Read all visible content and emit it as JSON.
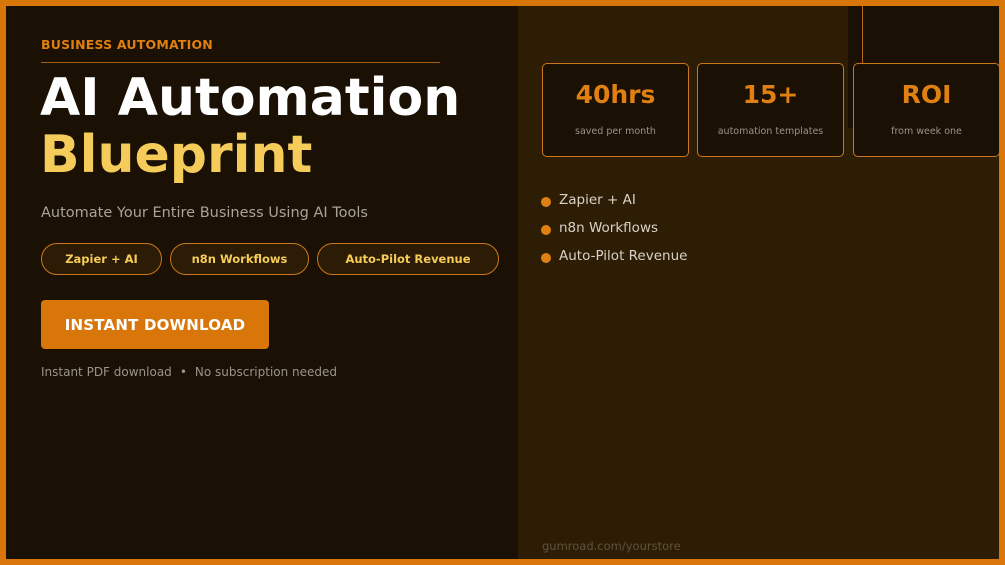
{
  "hero": {
    "eyebrow": "BUSINESS AUTOMATION",
    "title_line1": "AI Automation",
    "title_line2": "Blueprint",
    "subtitle": "Automate Your Entire Business Using AI Tools",
    "tags": [
      "Zapier + AI",
      "n8n Workflows",
      "Auto-Pilot Revenue"
    ],
    "cta_label": "INSTANT DOWNLOAD",
    "note_part1": "Instant PDF download",
    "note_separator": "•",
    "note_part2": "No subscription needed"
  },
  "stats": [
    {
      "value": "40hrs",
      "label": "saved per month"
    },
    {
      "value": "15+",
      "label": "automation templates"
    },
    {
      "value": "ROI",
      "label": "from week one"
    }
  ],
  "features": [
    "Zapier + AI",
    "n8n Workflows",
    "Auto-Pilot Revenue"
  ],
  "footer": {
    "url": "gumroad.com/yourstore"
  },
  "colors": {
    "accent": "#d9760a",
    "highlight": "#f5cc5a",
    "background": "#1a1003",
    "panel": "#2d1d05"
  }
}
